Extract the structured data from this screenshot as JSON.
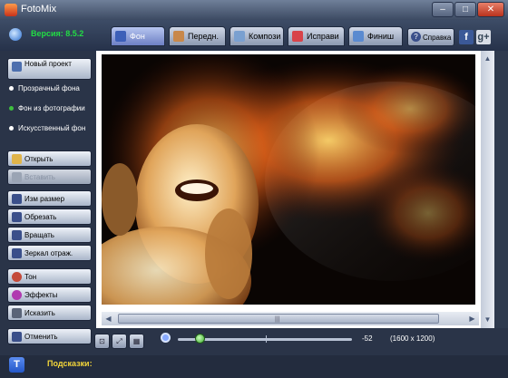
{
  "window": {
    "title": "FotoMix"
  },
  "header": {
    "version": "Версия: 8.5.2"
  },
  "tabs": [
    {
      "label": "Фон",
      "active": true,
      "icon": "background-icon"
    },
    {
      "label": "Передн.",
      "active": false,
      "icon": "person-icon"
    },
    {
      "label": "Компози",
      "active": false,
      "icon": "composition-icon"
    },
    {
      "label": "Исправи",
      "active": false,
      "icon": "pencil-icon"
    },
    {
      "label": "Финиш",
      "active": false,
      "icon": "finish-icon"
    }
  ],
  "help": {
    "label": "Справка"
  },
  "social": {
    "facebook": "f",
    "google": "g+"
  },
  "sidebar": {
    "new_project": "Новый проект",
    "radios": [
      {
        "label": "Прозрачный фона",
        "selected": false
      },
      {
        "label": "Фон из фотографии",
        "selected": true
      },
      {
        "label": "Искусственный фон",
        "selected": false
      }
    ],
    "open": "Открыть",
    "paste": "Вставить",
    "resize": "Изм размер",
    "crop": "Обрезать",
    "rotate": "Вращать",
    "mirror": "Зеркал отраж.",
    "tone": "Тон",
    "effects": "Эффекты",
    "distort": "Исказить",
    "undo": "Отменить"
  },
  "canvas": {
    "zoom_value": "-52",
    "zoom_position": 0.13,
    "image_size": "(1600 x 1200)"
  },
  "status": {
    "hints_label": "Подсказки:"
  },
  "colors": {
    "version_green": "#22dd44",
    "hints_yellow": "#f4d63a",
    "active_tab": "#6d7fc4"
  }
}
